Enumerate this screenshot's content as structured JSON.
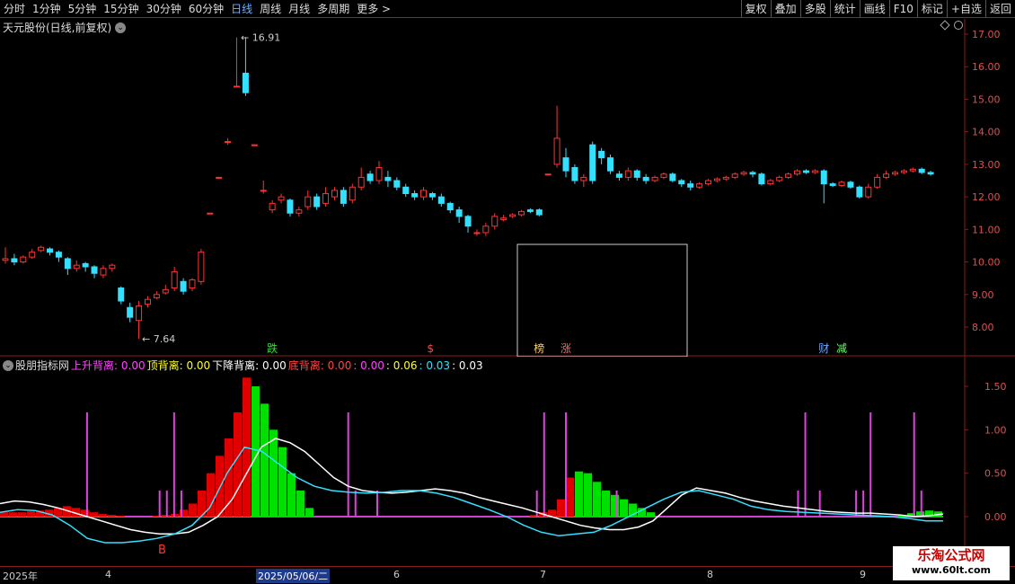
{
  "toolbar": {
    "periods": [
      "分时",
      "1分钟",
      "5分钟",
      "15分钟",
      "30分钟",
      "60分钟",
      "日线",
      "周线",
      "月线",
      "多周期",
      "更多 >"
    ],
    "active_period": "日线",
    "buttons": [
      "复权",
      "叠加",
      "多股",
      "统计",
      "画线",
      "F10",
      "标记",
      "+自选",
      "返回"
    ]
  },
  "stock": {
    "title": "天元股份(日线,前复权)",
    "high_label": "16.91",
    "low_label": "7.64"
  },
  "price_axis": [
    "17.00",
    "16.00",
    "15.00",
    "14.00",
    "13.00",
    "12.00",
    "11.00",
    "10.00",
    "9.00",
    "8.00"
  ],
  "event_markers": [
    "跌",
    "$",
    "榜",
    "涨",
    "财",
    "减"
  ],
  "indicator": {
    "name": "股朋指标网",
    "items": [
      {
        "label": "上升背离: 0.00",
        "color": "#ff44ff"
      },
      {
        "label": "顶背离: 0.00",
        "color": "#ffff33"
      },
      {
        "label": "下降背离: 0.00",
        "color": "#ffffff"
      },
      {
        "label": "底背离: 0.00",
        "color": "#ff4444"
      },
      {
        "label": ": 0.00",
        "color": "#ff44ff"
      },
      {
        "label": ": 0.06",
        "color": "#ffff33"
      },
      {
        "label": ": 0.03",
        "color": "#33e0ff"
      },
      {
        "label": ": 0.03",
        "color": "#ffffff"
      }
    ],
    "axis": [
      "1.50",
      "1.00",
      "0.50",
      "0.00"
    ],
    "buy_marker": "B"
  },
  "xaxis": {
    "labels": [
      "2025年",
      "4",
      "2025/05/06/二",
      "6",
      "7",
      "8",
      "9"
    ],
    "highlight": "2025/05/06/二"
  },
  "watermark": {
    "line1": "乐淘公式网",
    "line2": "www.60lt.com"
  },
  "colors": {
    "up": "#ff3333",
    "down": "#33e0ff",
    "grid": "#8b1a1a",
    "green_bar": "#00e000",
    "red_bar": "#e00000"
  },
  "chart_data": {
    "type": "candlestick",
    "ylim": [
      7.4,
      17.3
    ],
    "candles": [
      [
        10.05,
        10.1,
        10.45,
        9.95
      ],
      [
        10.1,
        10.0,
        10.25,
        9.9
      ],
      [
        10.0,
        10.15,
        10.2,
        9.95
      ],
      [
        10.15,
        10.3,
        10.4,
        10.1
      ],
      [
        10.35,
        10.45,
        10.5,
        10.3
      ],
      [
        10.4,
        10.3,
        10.45,
        10.2
      ],
      [
        10.3,
        10.15,
        10.35,
        10.0
      ],
      [
        10.1,
        9.8,
        10.15,
        9.6
      ],
      [
        9.8,
        9.9,
        10.05,
        9.7
      ],
      [
        9.95,
        9.85,
        10.0,
        9.7
      ],
      [
        9.85,
        9.65,
        9.9,
        9.5
      ],
      [
        9.6,
        9.8,
        9.9,
        9.5
      ],
      [
        9.8,
        9.9,
        9.95,
        9.7
      ],
      [
        9.2,
        8.8,
        9.25,
        8.7
      ],
      [
        8.6,
        8.3,
        8.75,
        8.15
      ],
      [
        8.2,
        8.65,
        8.8,
        7.64
      ],
      [
        8.7,
        8.85,
        8.95,
        8.6
      ],
      [
        8.9,
        9.0,
        9.1,
        8.85
      ],
      [
        9.05,
        9.15,
        9.3,
        9.0
      ],
      [
        9.2,
        9.7,
        9.85,
        9.1
      ],
      [
        9.4,
        9.1,
        9.5,
        9.0
      ],
      [
        9.2,
        9.45,
        9.5,
        9.1
      ],
      [
        9.4,
        10.3,
        10.4,
        9.3
      ],
      [
        11.5,
        11.5,
        11.5,
        11.5
      ],
      [
        12.6,
        12.6,
        12.6,
        12.6
      ],
      [
        13.7,
        13.7,
        13.8,
        13.6
      ],
      [
        15.4,
        15.4,
        16.9,
        15.4
      ],
      [
        15.8,
        15.2,
        16.91,
        15.1
      ],
      [
        13.6,
        13.6,
        13.6,
        13.6
      ],
      [
        12.2,
        12.2,
        12.5,
        12.1
      ],
      [
        11.6,
        11.8,
        11.9,
        11.5
      ],
      [
        11.9,
        12.0,
        12.1,
        11.8
      ],
      [
        11.9,
        11.5,
        11.95,
        11.4
      ],
      [
        11.5,
        11.6,
        11.7,
        11.4
      ],
      [
        11.7,
        12.0,
        12.2,
        11.6
      ],
      [
        12.0,
        11.7,
        12.1,
        11.6
      ],
      [
        11.8,
        12.1,
        12.3,
        11.7
      ],
      [
        12.0,
        12.2,
        12.3,
        11.9
      ],
      [
        12.2,
        11.8,
        12.3,
        11.7
      ],
      [
        11.9,
        12.3,
        12.4,
        11.8
      ],
      [
        12.3,
        12.6,
        12.9,
        12.2
      ],
      [
        12.7,
        12.5,
        12.8,
        12.4
      ],
      [
        12.5,
        12.9,
        13.1,
        12.4
      ],
      [
        12.6,
        12.5,
        12.8,
        12.3
      ],
      [
        12.5,
        12.3,
        12.6,
        12.2
      ],
      [
        12.3,
        12.1,
        12.4,
        12.0
      ],
      [
        12.1,
        12.0,
        12.2,
        11.9
      ],
      [
        12.0,
        12.2,
        12.3,
        11.9
      ],
      [
        12.1,
        12.0,
        12.15,
        11.9
      ],
      [
        12.0,
        11.8,
        12.1,
        11.7
      ],
      [
        11.8,
        11.6,
        11.85,
        11.5
      ],
      [
        11.6,
        11.4,
        11.7,
        11.2
      ],
      [
        11.4,
        11.1,
        11.45,
        10.9
      ],
      [
        10.9,
        10.9,
        11.0,
        10.8
      ],
      [
        10.9,
        11.1,
        11.2,
        10.8
      ],
      [
        11.1,
        11.4,
        11.5,
        11.0
      ],
      [
        11.3,
        11.35,
        11.45,
        11.25
      ],
      [
        11.4,
        11.45,
        11.5,
        11.35
      ],
      [
        11.45,
        11.55,
        11.6,
        11.4
      ],
      [
        11.6,
        11.55,
        11.65,
        11.5
      ],
      [
        11.6,
        11.45,
        11.65,
        11.4
      ],
      [
        12.7,
        12.7,
        12.7,
        12.7
      ],
      [
        13.0,
        13.8,
        14.8,
        12.9
      ],
      [
        13.2,
        12.8,
        13.5,
        12.6
      ],
      [
        12.9,
        12.5,
        13.0,
        12.4
      ],
      [
        12.5,
        12.6,
        12.7,
        12.3
      ],
      [
        13.6,
        12.5,
        13.7,
        12.4
      ],
      [
        13.4,
        13.2,
        13.5,
        13.0
      ],
      [
        13.2,
        12.8,
        13.3,
        12.7
      ],
      [
        12.7,
        12.6,
        12.8,
        12.5
      ],
      [
        12.6,
        12.8,
        12.9,
        12.5
      ],
      [
        12.8,
        12.6,
        12.85,
        12.5
      ],
      [
        12.6,
        12.5,
        12.7,
        12.4
      ],
      [
        12.5,
        12.6,
        12.65,
        12.45
      ],
      [
        12.6,
        12.7,
        12.75,
        12.55
      ],
      [
        12.7,
        12.5,
        12.75,
        12.45
      ],
      [
        12.5,
        12.4,
        12.55,
        12.3
      ],
      [
        12.4,
        12.3,
        12.5,
        12.2
      ],
      [
        12.3,
        12.4,
        12.45,
        12.25
      ],
      [
        12.4,
        12.5,
        12.55,
        12.35
      ],
      [
        12.5,
        12.55,
        12.6,
        12.45
      ],
      [
        12.55,
        12.6,
        12.65,
        12.5
      ],
      [
        12.6,
        12.7,
        12.75,
        12.55
      ],
      [
        12.7,
        12.75,
        12.8,
        12.65
      ],
      [
        12.75,
        12.7,
        12.8,
        12.6
      ],
      [
        12.7,
        12.4,
        12.75,
        12.35
      ],
      [
        12.4,
        12.5,
        12.55,
        12.35
      ],
      [
        12.5,
        12.6,
        12.65,
        12.45
      ],
      [
        12.6,
        12.7,
        12.75,
        12.55
      ],
      [
        12.7,
        12.8,
        12.85,
        12.65
      ],
      [
        12.8,
        12.75,
        12.85,
        12.7
      ],
      [
        12.75,
        12.8,
        12.85,
        12.7
      ],
      [
        12.8,
        12.4,
        12.85,
        11.8
      ],
      [
        12.4,
        12.35,
        12.45,
        12.3
      ],
      [
        12.35,
        12.45,
        12.5,
        12.3
      ],
      [
        12.45,
        12.3,
        12.5,
        12.25
      ],
      [
        12.3,
        12.0,
        12.35,
        11.95
      ],
      [
        12.0,
        12.3,
        12.4,
        11.95
      ],
      [
        12.3,
        12.6,
        12.7,
        12.25
      ],
      [
        12.6,
        12.7,
        12.8,
        12.55
      ],
      [
        12.7,
        12.75,
        12.8,
        12.65
      ],
      [
        12.75,
        12.8,
        12.85,
        12.7
      ],
      [
        12.8,
        12.85,
        12.9,
        12.75
      ],
      [
        12.85,
        12.75,
        12.9,
        12.7
      ],
      [
        12.75,
        12.7,
        12.8,
        12.65
      ]
    ],
    "x_events": [
      {
        "label": "跌",
        "i": 30
      },
      {
        "label": "$",
        "i": 48
      },
      {
        "label": "榜",
        "i": 60
      },
      {
        "label": "涨",
        "i": 63
      },
      {
        "label": "财",
        "i": 92
      },
      {
        "label": "减",
        "i": 94
      }
    ],
    "indicator_bars": [
      0.05,
      0.05,
      0.05,
      0.06,
      0.07,
      0.08,
      0.1,
      0.12,
      0.1,
      0.08,
      0.05,
      0.03,
      0.02,
      0.01,
      0.0,
      0.0,
      0.0,
      0.01,
      0.02,
      0.03,
      0.08,
      0.15,
      0.3,
      0.5,
      0.7,
      0.9,
      1.2,
      1.6,
      1.5,
      1.3,
      1.0,
      0.8,
      0.5,
      0.3,
      0.1,
      0.0,
      0.0,
      0.0,
      0.0,
      0.0,
      0.0,
      0.0,
      0.0,
      0.0,
      0.0,
      0.0,
      0.0,
      0.0,
      0.0,
      0.0,
      0.0,
      0.0,
      0.0,
      0.0,
      0.0,
      0.0,
      0.0,
      0.0,
      0.0,
      0.02,
      0.05,
      0.08,
      0.2,
      0.45,
      0.52,
      0.5,
      0.4,
      0.3,
      0.25,
      0.2,
      0.15,
      0.1,
      0.05,
      0.0,
      0.0,
      0.0,
      0.0,
      0.0,
      0.0,
      0.0,
      0.0,
      0.0,
      0.0,
      0.0,
      0.0,
      0.0,
      0.0,
      0.0,
      0.0,
      0.0,
      0.0,
      0.0,
      0.0,
      0.0,
      0.0,
      0.0,
      0.0,
      0.0,
      0.0,
      0.0,
      0.02,
      0.04,
      0.06,
      0.07,
      0.06
    ],
    "white_line": [
      0.15,
      0.18,
      0.17,
      0.14,
      0.1,
      0.05,
      0.0,
      -0.05,
      -0.1,
      -0.15,
      -0.18,
      -0.2,
      -0.2,
      -0.18,
      -0.1,
      0.0,
      0.2,
      0.5,
      0.8,
      0.9,
      0.85,
      0.75,
      0.6,
      0.45,
      0.35,
      0.3,
      0.28,
      0.27,
      0.28,
      0.3,
      0.32,
      0.3,
      0.27,
      0.22,
      0.18,
      0.14,
      0.1,
      0.05,
      0.0,
      -0.05,
      -0.1,
      -0.13,
      -0.15,
      -0.15,
      -0.12,
      -0.05,
      0.1,
      0.25,
      0.33,
      0.3,
      0.27,
      0.22,
      0.18,
      0.15,
      0.12,
      0.1,
      0.08,
      0.06,
      0.05,
      0.04,
      0.04,
      0.03,
      0.02,
      0.0,
      0.01,
      0.03
    ],
    "cyan_line": [
      0.05,
      0.08,
      0.07,
      0.02,
      -0.1,
      -0.25,
      -0.3,
      -0.3,
      -0.28,
      -0.25,
      -0.2,
      -0.1,
      0.1,
      0.5,
      0.8,
      0.75,
      0.6,
      0.45,
      0.35,
      0.3,
      0.28,
      0.27,
      0.28,
      0.3,
      0.3,
      0.27,
      0.22,
      0.15,
      0.08,
      0.0,
      -0.1,
      -0.18,
      -0.22,
      -0.2,
      -0.18,
      -0.1,
      0.0,
      0.1,
      0.2,
      0.28,
      0.3,
      0.25,
      0.2,
      0.12,
      0.08,
      0.06,
      0.05,
      0.04,
      0.03,
      0.02,
      0.01,
      0.0,
      -0.02,
      -0.05,
      -0.05
    ],
    "magenta_spikes": [
      12,
      22,
      23,
      24,
      25,
      48,
      49,
      52,
      74,
      75,
      78,
      85,
      110,
      111,
      113,
      118,
      119,
      120,
      126,
      127
    ]
  }
}
